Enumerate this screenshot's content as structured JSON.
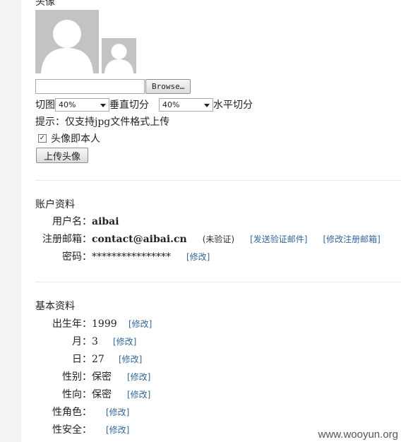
{
  "avatar": {
    "title": "头像",
    "file_input_value": "",
    "browse_label": "Browse…",
    "crop_label": "切图",
    "vertical_select": "40%",
    "vertical_label": "垂直切分",
    "horizontal_select": "40%",
    "horizontal_label": "水平切分",
    "tip": "提示：仅支持jpg文件格式上传",
    "checkbox_label": "头像即本人",
    "checkbox_checked": true,
    "upload_label": "上传头像"
  },
  "account": {
    "title": "账户资料",
    "username_label": "用户名：",
    "username": "aibai",
    "email_label": "注册邮箱：",
    "email": "contact@aibai.cn",
    "email_status": "(未验证)",
    "send_verify_link": "[发送验证邮件]",
    "edit_email_link": "[修改注册邮箱]",
    "password_label": "密码：",
    "password_mask": "****************",
    "edit_password_link": "[修改]"
  },
  "basic": {
    "title": "基本资料",
    "rows": [
      {
        "label": "出生年：",
        "value": "1999",
        "edit": "[修改]"
      },
      {
        "label": "月：",
        "value": "3",
        "edit": "[修改]"
      },
      {
        "label": "日：",
        "value": "27",
        "edit": "[修改]"
      },
      {
        "label": "性别：",
        "value": "保密",
        "edit": "[修改]"
      },
      {
        "label": "性向：",
        "value": "保密",
        "edit": "[修改]"
      },
      {
        "label": "性角色：",
        "value": "",
        "edit": "[修改]"
      },
      {
        "label": "性安全：",
        "value": "",
        "edit": "[修改]"
      }
    ]
  },
  "watermark": "www.wooyun.org"
}
